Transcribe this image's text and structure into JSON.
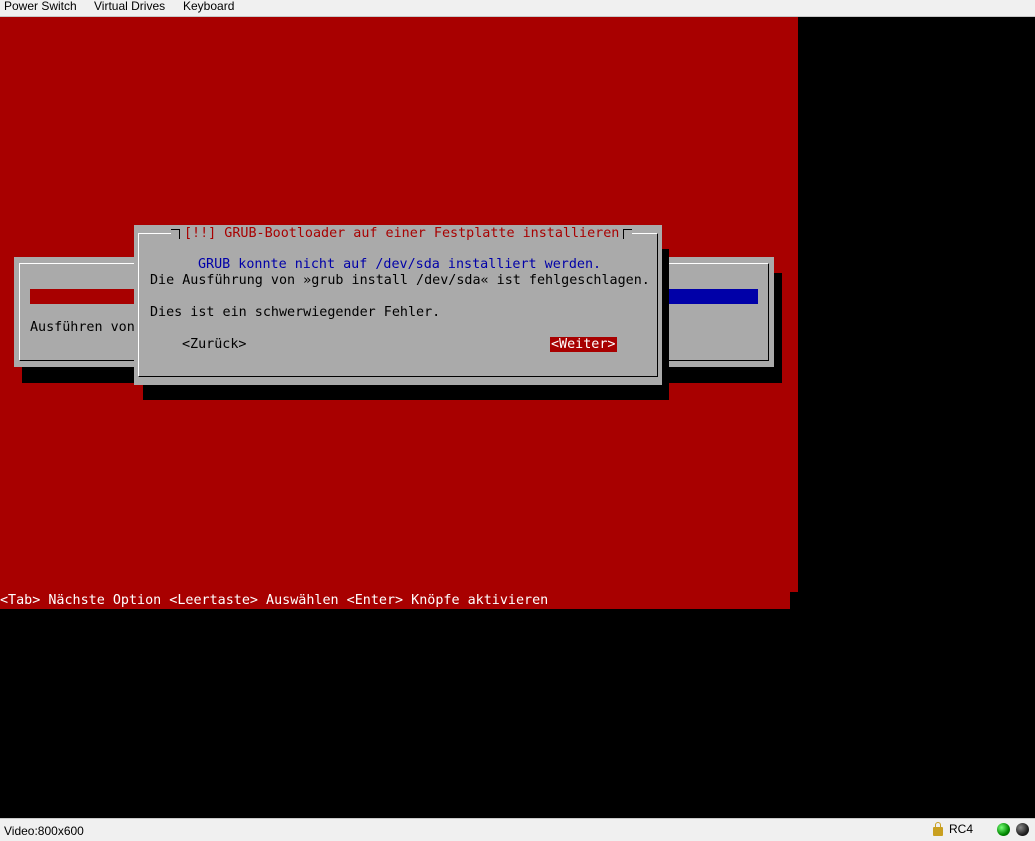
{
  "menu": [
    "Power Switch",
    "Virtual Drives",
    "Keyboard"
  ],
  "background_dialog": {
    "text": "Ausführen von"
  },
  "dialog": {
    "title": "[!!] GRUB-Bootloader auf einer Festplatte installieren",
    "message_error": "GRUB konnte nicht auf /dev/sda installiert werden.",
    "message_detail": "Die Ausführung von »grub install /dev/sda« ist fehlgeschlagen.",
    "message_severity": "Dies ist ein schwerwiegender Fehler.",
    "back_button": "<Zurück>",
    "next_button": "<Weiter>"
  },
  "help_bar": "<Tab> Nächste Option <Leertaste> Auswählen <Enter> Knöpfe aktivieren",
  "status": {
    "video": "Video:800x600",
    "cipher": "RC4",
    "lock_icon": "lock-icon",
    "led_colors": [
      "#008800",
      "#222222"
    ]
  },
  "colors": {
    "installer_red": "#a80000",
    "dialog_gray": "#aaaaaa",
    "progress_blue": "#0000a8"
  }
}
